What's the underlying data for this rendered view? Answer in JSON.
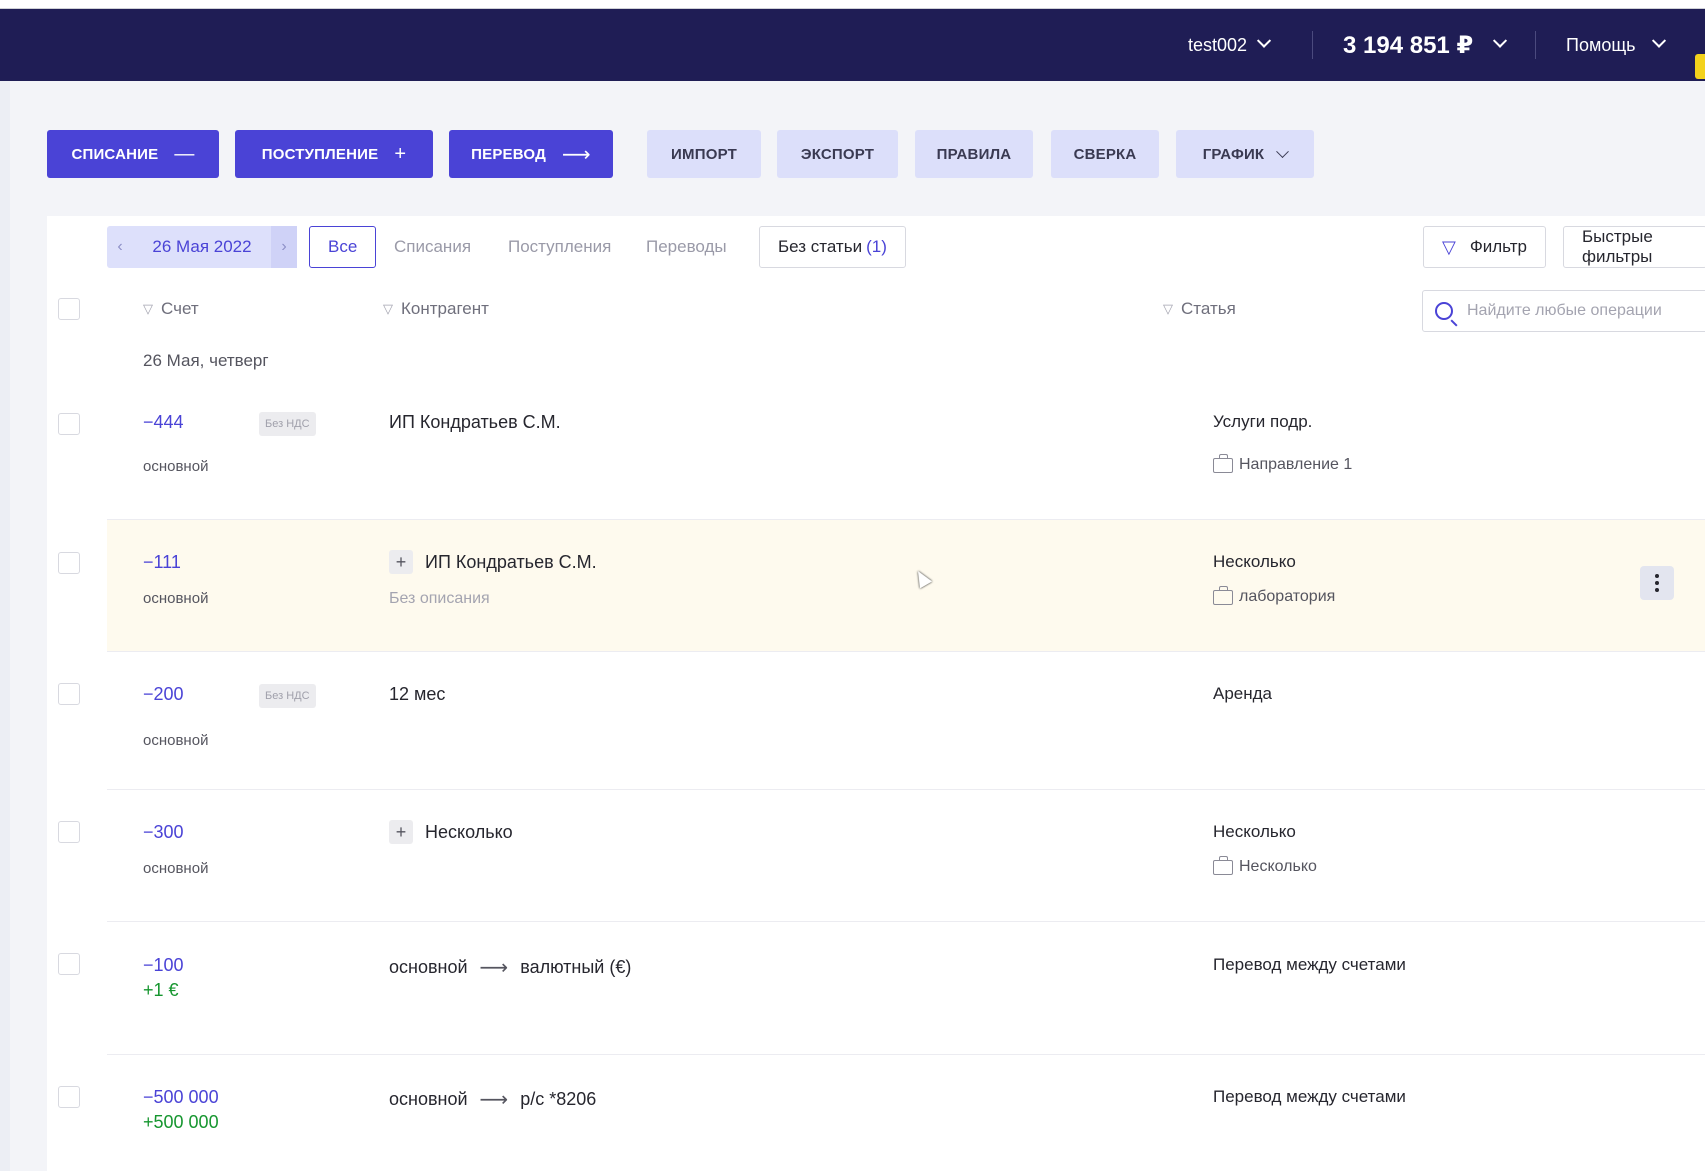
{
  "topbar": {
    "user": "test002",
    "balance": "3 194 851 ₽",
    "help": "Помощь"
  },
  "toolbar": {
    "writeoff": "СПИСАНИЕ",
    "writeoff_icon": "—",
    "income": "ПОСТУПЛЕНИЕ",
    "income_icon": "+",
    "transfer": "ПЕРЕВОД",
    "transfer_icon": "⟶",
    "import": "ИМПОРТ",
    "export": "ЭКСПОРТ",
    "rules": "ПРАВИЛА",
    "reconcile": "СВЕРКА",
    "chart": "ГРАФИК"
  },
  "date_nav": {
    "date": "26 Мая 2022",
    "prev": "‹",
    "next": "›"
  },
  "tabs": {
    "all": "Все",
    "writeoffs": "Списания",
    "incomes": "Поступления",
    "transfers": "Переводы",
    "no_article": "Без статьи",
    "no_article_count": "(1)"
  },
  "filters": {
    "filter": "Фильтр",
    "quick": "Быстрые фильтры"
  },
  "search": {
    "placeholder": "Найдите любые операции"
  },
  "columns": {
    "account": "Счет",
    "counterparty": "Контрагент",
    "article": "Статья"
  },
  "day_header": "26 Мая, четверг",
  "rows": [
    {
      "amount": "−444",
      "nds": "Без НДС",
      "account": "основной",
      "party": "ИП Кондратьев С.М.",
      "article": "Услуги подр.",
      "direction": "Направление 1"
    },
    {
      "amount": "−111",
      "account": "основной",
      "party_plus": "+",
      "party": "ИП Кондратьев С.М.",
      "description": "Без описания",
      "article": "Несколько",
      "direction": "лаборатория"
    },
    {
      "amount": "−200",
      "nds": "Без НДС",
      "account": "основной",
      "party": "12 мес",
      "article": "Аренда"
    },
    {
      "amount": "−300",
      "account": "основной",
      "party_plus": "+",
      "party": "Несколько",
      "article": "Несколько",
      "direction": "Несколько"
    },
    {
      "amount": "−100",
      "amount2": "+1 €",
      "party_from": "основной",
      "party_arrow": "⟶",
      "party_to": "валютный (€)",
      "article": "Перевод между счетами"
    },
    {
      "amount": "−500 000",
      "amount2": "+500 000",
      "party_from": "основной",
      "party_arrow": "⟶",
      "party_to": "р/с *8206",
      "article": "Перевод между счетами"
    }
  ]
}
